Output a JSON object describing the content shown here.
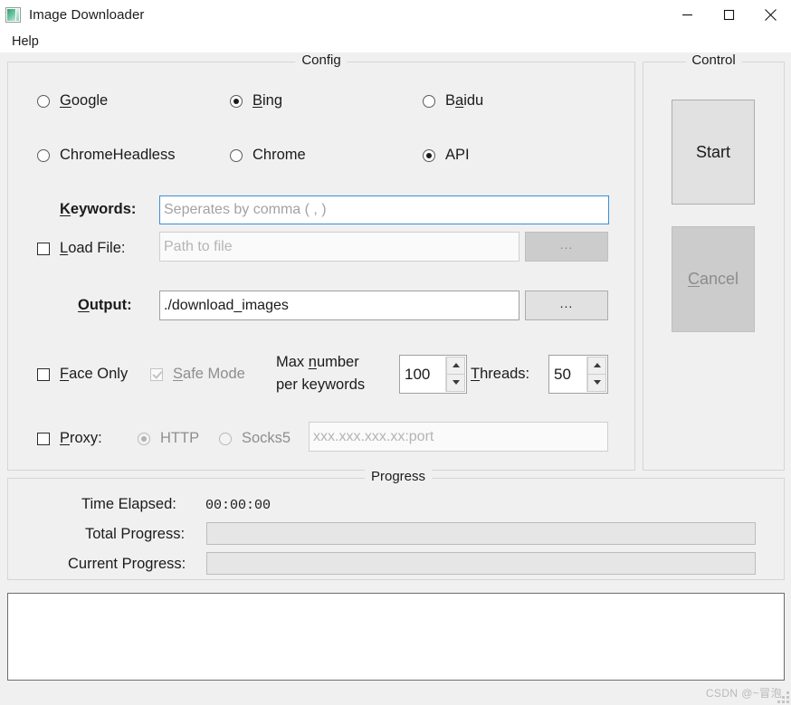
{
  "window": {
    "title": "Image Downloader",
    "icon": "image-icon",
    "controls": {
      "minimize": "minimize-icon",
      "maximize": "maximize-icon",
      "close": "close-icon"
    }
  },
  "menubar": {
    "items": [
      {
        "label": "Help",
        "accelerator": "H"
      }
    ]
  },
  "config": {
    "title": "Config",
    "engines": [
      {
        "label": "Google",
        "accelerator": "G",
        "checked": false
      },
      {
        "label": "Bing",
        "accelerator": "B",
        "checked": true
      },
      {
        "label": "Baidu",
        "accelerator": "a",
        "checked": false
      },
      {
        "label": "ChromeHeadless",
        "accelerator": "",
        "checked": false
      },
      {
        "label": "Chrome",
        "accelerator": "",
        "checked": false
      },
      {
        "label": "API",
        "accelerator": "",
        "checked": true
      }
    ],
    "keywords": {
      "label": "Keywords:",
      "accelerator": "K",
      "value": "",
      "placeholder": "Seperates by comma ( , )",
      "focused": true
    },
    "load_file": {
      "label": "Load File:",
      "accelerator": "L",
      "checked": false,
      "value": "",
      "placeholder": "Path to file",
      "browse_label": "...",
      "browse_enabled": false
    },
    "output": {
      "label": "Output:",
      "accelerator": "O",
      "value": "./download_images",
      "browse_label": "...",
      "browse_enabled": true
    },
    "face_only": {
      "label": "Face Only",
      "accelerator": "F",
      "checked": false,
      "enabled": true
    },
    "safe_mode": {
      "label": "Safe Mode",
      "accelerator": "S",
      "checked": true,
      "enabled": false
    },
    "max_number": {
      "label_line1": "Max number",
      "label_line2": "per keywords",
      "accelerator": "n",
      "value": "100"
    },
    "threads": {
      "label": "Threads:",
      "accelerator": "T",
      "value": "50"
    },
    "proxy": {
      "label": "Proxy:",
      "accelerator": "P",
      "checked": false,
      "types": [
        {
          "label": "HTTP",
          "checked": true,
          "enabled": false
        },
        {
          "label": "Socks5",
          "checked": false,
          "enabled": false
        }
      ],
      "value": "",
      "placeholder": "xxx.xxx.xxx.xx:port",
      "enabled": false
    }
  },
  "control": {
    "title": "Control",
    "start": {
      "label": "Start",
      "accelerator": "",
      "enabled": true
    },
    "cancel": {
      "label": "Cancel",
      "accelerator": "C",
      "enabled": false
    }
  },
  "progress": {
    "title": "Progress",
    "time_elapsed": {
      "label": "Time Elapsed:",
      "value": "00:00:00"
    },
    "total": {
      "label": "Total Progress:",
      "percent": 0
    },
    "current": {
      "label": "Current Progress:",
      "percent": 0
    }
  },
  "log": {
    "content": ""
  },
  "watermark": {
    "text": "CSDN @~冒泡"
  },
  "colors": {
    "window_bg": "#f0f0f0",
    "accent_focus": "#3b8fd4",
    "progress_fill": "#06b025",
    "disabled_text": "#8e8e8e"
  }
}
